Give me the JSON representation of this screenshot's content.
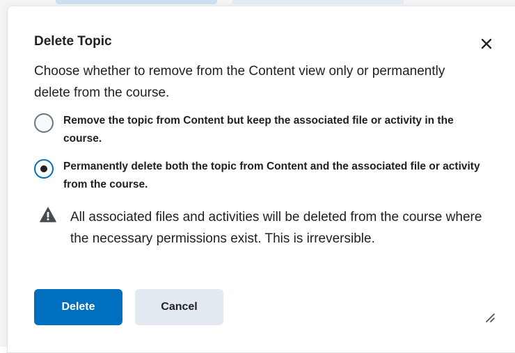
{
  "dialog": {
    "title": "Delete Topic",
    "description": "Choose whether to remove from the Content view only or permanently delete from the course.",
    "options": [
      {
        "label": "Remove the topic from Content but keep the associated file or activity in the course.",
        "selected": false
      },
      {
        "label": "Permanently delete both the topic from Content and the associated file or activity from the course.",
        "selected": true
      }
    ],
    "warning": "All associated files and activities will be deleted from the course where the necessary permissions exist. This is irreversible.",
    "buttons": {
      "delete_label": "Delete",
      "cancel_label": "Cancel"
    },
    "icons": {
      "close": "close-icon",
      "warning": "warning-icon",
      "resize": "resize-grip-icon"
    }
  },
  "colors": {
    "primary": "#006fbf",
    "secondary_button": "#e3e9f1",
    "text": "#202122"
  }
}
